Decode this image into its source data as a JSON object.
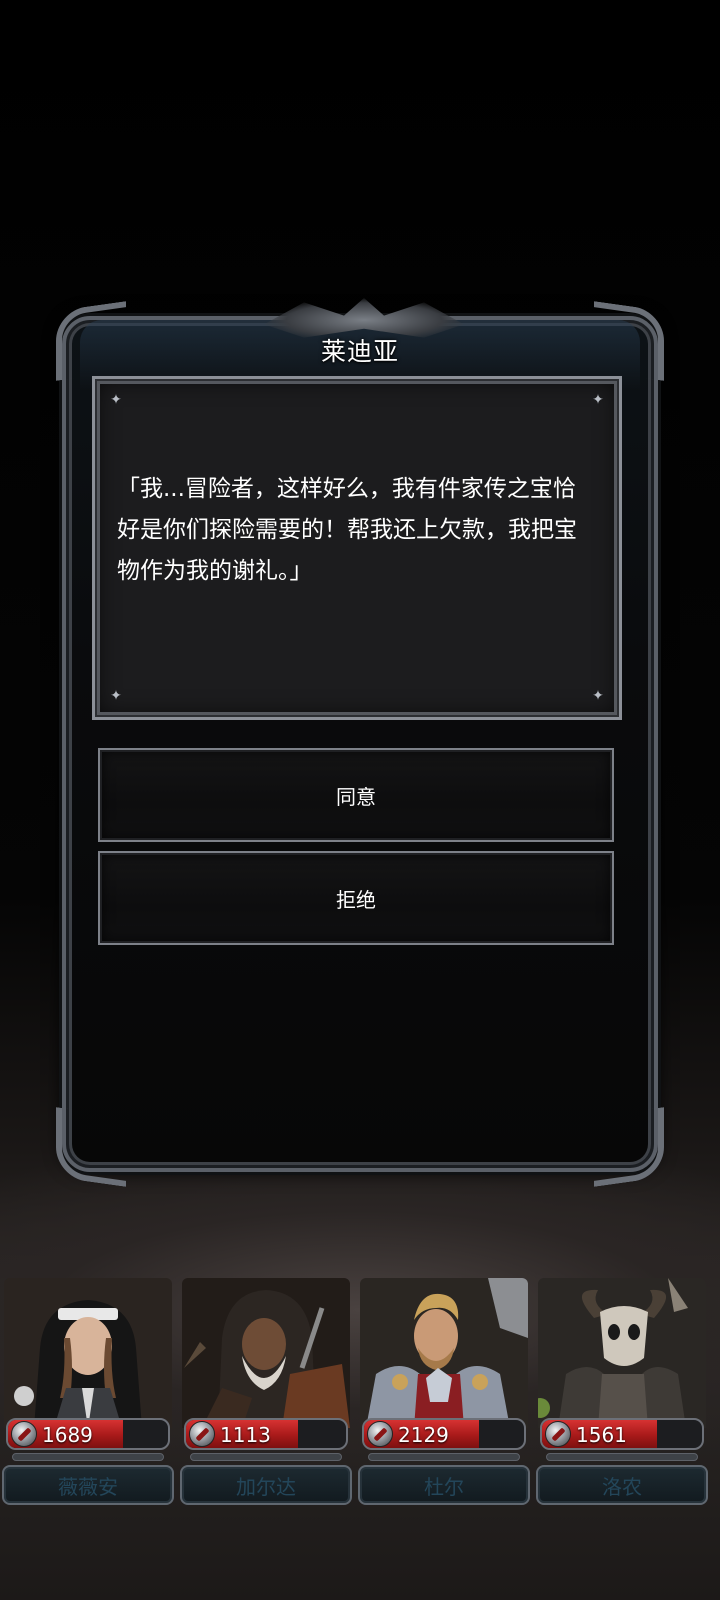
{
  "dialog": {
    "title": "莱迪亚",
    "message": "「我...冒险者，这样好么，我有件家传之宝恰好是你们探险需要的！帮我还上欠款，我把宝物作为我的谢礼。」",
    "choices": {
      "agree_label": "同意",
      "refuse_label": "拒绝"
    }
  },
  "party": [
    {
      "name": "薇薇安",
      "hp": "1689",
      "hp_fill": 0.72,
      "portrait_icon": "nun-heroine-portrait"
    },
    {
      "name": "加尔达",
      "hp": "1113",
      "hp_fill": 0.7,
      "portrait_icon": "hooded-old-warrior-portrait"
    },
    {
      "name": "杜尔",
      "hp": "2129",
      "hp_fill": 0.72,
      "portrait_icon": "armored-paladin-portrait"
    },
    {
      "name": "洛农",
      "hp": "1561",
      "hp_fill": 0.72,
      "portrait_icon": "skull-masked-beast-portrait"
    }
  ],
  "colors": {
    "hp_red": "#c42020",
    "frame_silver": "#7d8189",
    "name_text": "#23465a"
  }
}
